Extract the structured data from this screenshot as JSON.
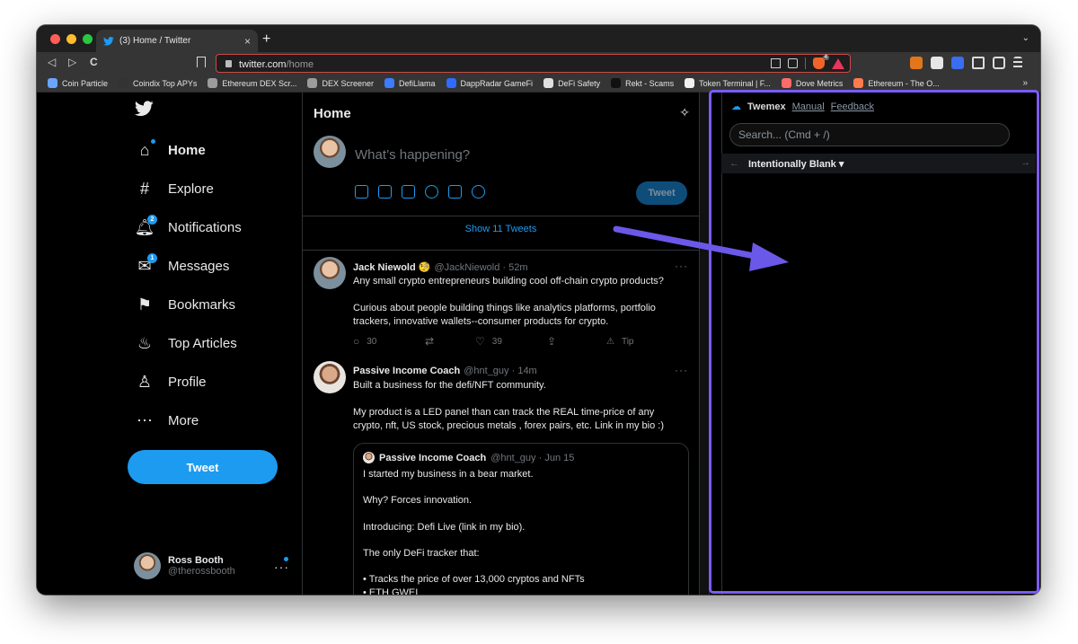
{
  "browser": {
    "tab_title": "(3) Home / Twitter",
    "tab_close": "×",
    "new_tab": "+",
    "tab_menu": "⌄",
    "url_host": "twitter.com",
    "url_path": "/home",
    "back": "◁",
    "forward": "▷",
    "reload": "C",
    "ext_badge": "4",
    "bookmarks": [
      {
        "label": "Coin Particle",
        "color": "#6aa4ff"
      },
      {
        "label": "Coindix Top APYs",
        "color": "#333333"
      },
      {
        "label": "Ethereum DEX Scr...",
        "color": "#9c9c9c"
      },
      {
        "label": "DEX Screener",
        "color": "#9c9c9c"
      },
      {
        "label": "DefiLlama",
        "color": "#3d7bff"
      },
      {
        "label": "DappRadar GameFi",
        "color": "#2f6bff"
      },
      {
        "label": "DeFi Safety",
        "color": "#e0e0e0"
      },
      {
        "label": "Rekt - Scams",
        "color": "#111111"
      },
      {
        "label": "Token Terminal | F...",
        "color": "#f1f1f1"
      },
      {
        "label": "Dove Metrics",
        "color": "#ff6b6b"
      },
      {
        "label": "Ethereum - The O...",
        "color": "#ff7a4d"
      }
    ],
    "bookmarks_more": "»"
  },
  "sidebar": {
    "items": [
      {
        "label": "Home",
        "icon": "home-icon",
        "glyph": "⌂"
      },
      {
        "label": "Explore",
        "icon": "hashtag-icon",
        "glyph": "#"
      },
      {
        "label": "Notifications",
        "icon": "bell-icon",
        "glyph": "🔔︎",
        "badge": "2"
      },
      {
        "label": "Messages",
        "icon": "envelope-icon",
        "glyph": "✉",
        "badge": "1"
      },
      {
        "label": "Bookmarks",
        "icon": "bookmark-icon",
        "glyph": "⚑"
      },
      {
        "label": "Top Articles",
        "icon": "flame-icon",
        "glyph": "♨"
      },
      {
        "label": "Profile",
        "icon": "person-icon",
        "glyph": "♙"
      },
      {
        "label": "More",
        "icon": "more-circle-icon",
        "glyph": "⋯"
      }
    ],
    "tweet_button": "Tweet",
    "account": {
      "name": "Ross Booth",
      "handle": "@therossbooth",
      "more": "···"
    }
  },
  "timeline": {
    "title": "Home",
    "compose_placeholder": "What’s happening?",
    "compose_button": "Tweet",
    "show_tweets": "Show 11 Tweets",
    "tweets": [
      {
        "name": "Jack Niewold 🧐",
        "handle": "@JackNiewold · 52m",
        "dots": "···",
        "lines": [
          "Any small crypto entrepreneurs building cool off-chain crypto products?",
          "",
          "Curious about people building things like analytics platforms, portfolio",
          "trackers, innovative wallets--consumer products for crypto."
        ],
        "actions": {
          "reply": "30",
          "retweet": "",
          "like": "39",
          "share": "",
          "tip": "Tip"
        }
      },
      {
        "name": "Passive Income Coach",
        "handle": "@hnt_guy · 14m",
        "dots": "···",
        "lines": [
          "Built a business for the defi/NFT community.",
          "",
          "My product is a LED panel than can track the REAL time-price of any",
          "crypto, nft, US stock, precious metals , forex pairs, etc. Link in my bio :)"
        ],
        "quote": {
          "name": "Passive Income Coach",
          "handle": "@hnt_guy · Jun 15",
          "lines": [
            "I started my business in a bear market.",
            "Why? Forces innovation.",
            "Introducing: Defi Live (link in my bio).",
            "The only DeFi tracker that:",
            "• Tracks the price of over 13,000 cryptos and NFTs",
            "• ETH GWEI"
          ]
        }
      }
    ]
  },
  "twemex": {
    "title": "Twemex",
    "manual": "Manual",
    "feedback": "Feedback",
    "search_placeholder": "Search... (Cmd + /)",
    "list_name": "Intentionally Blank ▾",
    "prev": "←",
    "next": "→"
  },
  "colors": {
    "accent": "#1d9bf0",
    "highlight": "#7b5cff",
    "arrow": "#6a58e8"
  }
}
